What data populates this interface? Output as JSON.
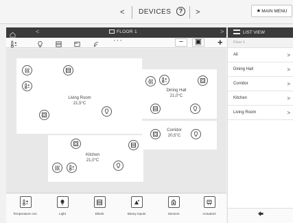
{
  "topbar": {
    "prev_glyph": "<",
    "title": "DEVICES",
    "next_glyph": ">",
    "help_glyph": "?",
    "main_menu_label": "MAIN MENU",
    "main_menu_icon": "star-icon"
  },
  "floor_header": {
    "home_icon": "home-icon",
    "back_glyph": "<",
    "title": "FLOOR 1",
    "forward_glyph": ">"
  },
  "toolbar": {
    "more_glyph": "···",
    "zoom_out_glyph": "−",
    "fit_glyph": "▣",
    "zoom_in_glyph": "+"
  },
  "rooms": {
    "living_room": {
      "name": "Living Room",
      "temp": "21,5°C"
    },
    "dining_hall": {
      "name": "Dining Hall",
      "temp": "21,0°C"
    },
    "corridor": {
      "name": "Corridor",
      "temp": "20,5°C"
    },
    "kitchen": {
      "name": "Kitchen",
      "temp": "21,0°C"
    }
  },
  "tabs": [
    {
      "label": "Temperature con.",
      "icon": "thermostat-icon"
    },
    {
      "label": "Light",
      "icon": "bulb-icon"
    },
    {
      "label": "Blinds",
      "icon": "blinds-icon"
    },
    {
      "label": "Binary inputs",
      "icon": "binary-input-icon"
    },
    {
      "label": "Sensors",
      "icon": "sensor-icon"
    },
    {
      "label": "Actuators",
      "icon": "actuator-icon"
    }
  ],
  "list_view": {
    "title": "LIST VIEW",
    "subtitle": "Floor 1",
    "items": [
      {
        "label": "All"
      },
      {
        "label": "Dining Hall"
      },
      {
        "label": "Corridor"
      },
      {
        "label": "Kitchen"
      },
      {
        "label": "Living Room"
      }
    ],
    "chevron": ">",
    "back_icon": "back-arrow-icon"
  }
}
